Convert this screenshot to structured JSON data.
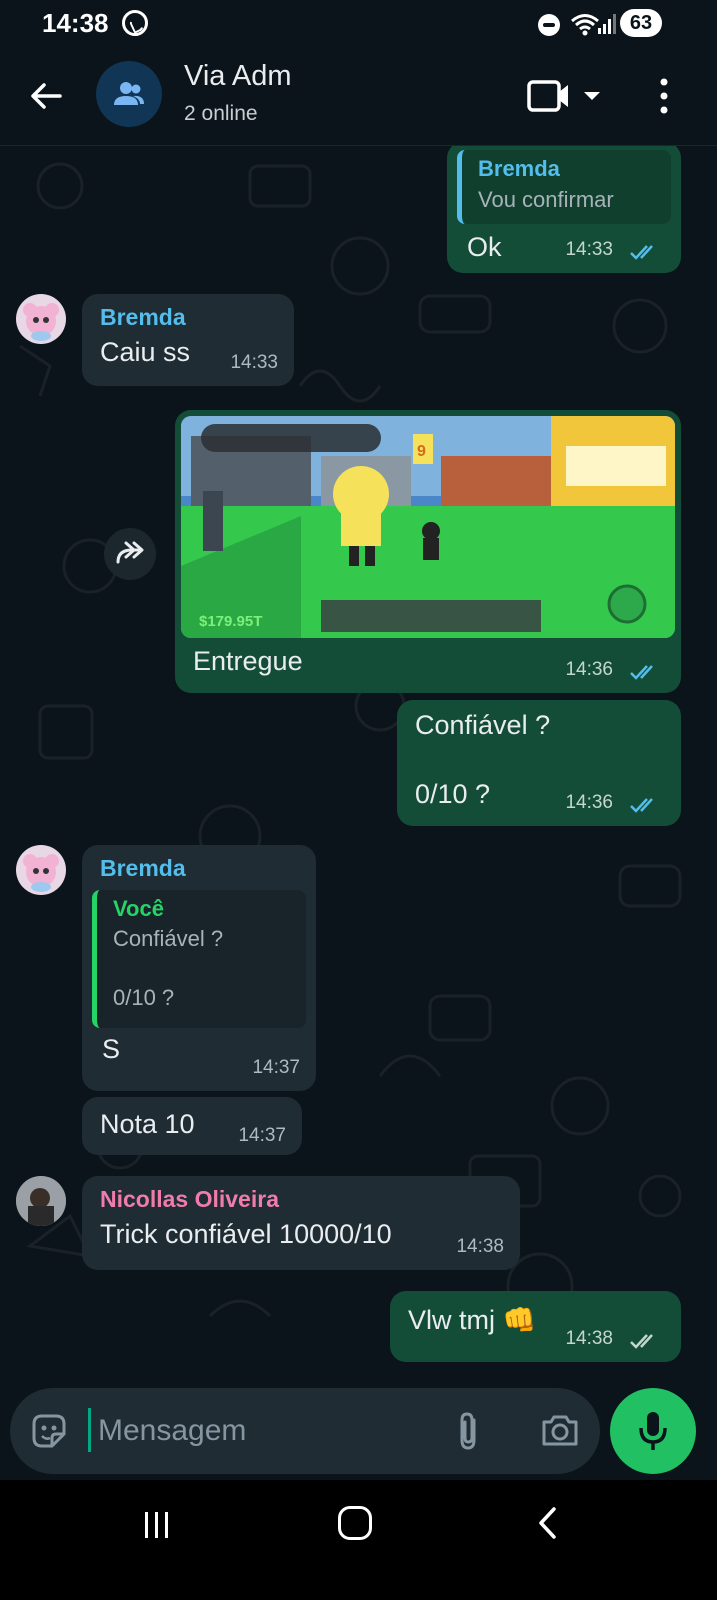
{
  "status_bar": {
    "time": "14:38",
    "battery": "63"
  },
  "header": {
    "title": "Via Adm",
    "subtitle": "2 online"
  },
  "messages": {
    "m1": {
      "quote_sender": "Bremda",
      "quote_text": "Vou confirmar",
      "text": "Ok",
      "time": "14:33"
    },
    "m2": {
      "sender": "Bremda",
      "text": "Caiu ss",
      "time": "14:33"
    },
    "m3": {
      "image": {
        "money": "$179.95T",
        "sign_number": "9"
      },
      "caption": "Entregue",
      "time": "14:36"
    },
    "m4": {
      "text": "Confiável ?\n\n0/10 ?",
      "time": "14:36"
    },
    "m5": {
      "sender": "Bremda",
      "quote_sender": "Você",
      "quote_text": "Confiável ?\n\n0/10 ?",
      "text": "S",
      "time": "14:37"
    },
    "m6": {
      "text": "Nota 10",
      "time": "14:37"
    },
    "m7": {
      "sender": "Nicollas Oliveira",
      "text": "Trick confiável 10000/10",
      "time": "14:38"
    },
    "m8": {
      "text": "Vlw tmj 👊",
      "time": "14:38"
    }
  },
  "input": {
    "placeholder": "Mensagem"
  },
  "colors": {
    "background": "#0b141a",
    "incoming_bubble": "#1f2c34",
    "outgoing_bubble": "#144d37",
    "read_ticks": "#53bdeb",
    "sender_bremda": "#53bdeb",
    "sender_nicollas": "#f07cab",
    "quote_voce": "#25d366",
    "mic_button": "#21c063"
  },
  "icons": [
    "back-arrow-icon",
    "group-icon",
    "video-call-icon",
    "dropdown-icon",
    "more-vert-icon",
    "forward-icon",
    "double-check-icon",
    "sticker-icon",
    "attach-icon",
    "camera-icon",
    "mic-icon",
    "nav-recents-icon",
    "nav-home-icon",
    "nav-back-icon"
  ]
}
